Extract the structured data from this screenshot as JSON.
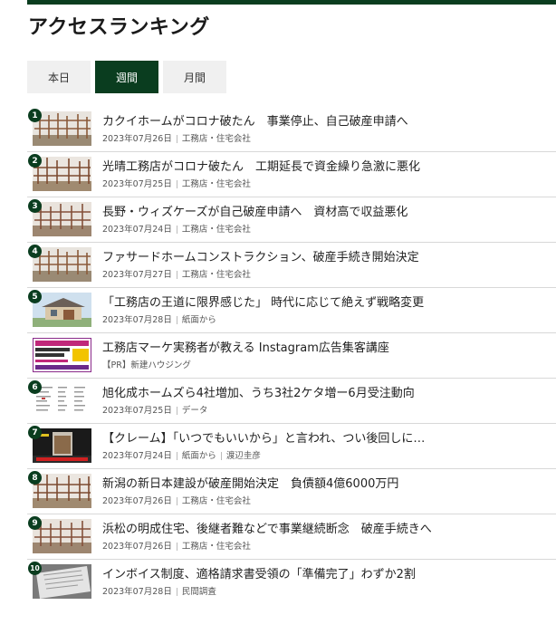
{
  "header": {
    "title": "アクセスランキング"
  },
  "tabs": [
    {
      "label": "本日"
    },
    {
      "label": "週間"
    },
    {
      "label": "月間"
    }
  ],
  "items": [
    {
      "rank": "1",
      "headline": "カクイホームがコロナ破たん　事業停止、自己破産申請へ",
      "date": "2023年07月26日",
      "category": "工務店・住宅会社",
      "author": ""
    },
    {
      "rank": "2",
      "headline": "光晴工務店がコロナ破たん　工期延長で資金繰り急激に悪化",
      "date": "2023年07月25日",
      "category": "工務店・住宅会社",
      "author": ""
    },
    {
      "rank": "3",
      "headline": "長野・ウィズケーズが自己破産申請へ　資材高で収益悪化",
      "date": "2023年07月24日",
      "category": "工務店・住宅会社",
      "author": ""
    },
    {
      "rank": "4",
      "headline": "ファサードホームコンストラクション、破産手続き開始決定",
      "date": "2023年07月27日",
      "category": "工務店・住宅会社",
      "author": ""
    },
    {
      "rank": "5",
      "headline": "「工務店の王道に限界感じた」 時代に応じて絶えず戦略変更",
      "date": "2023年07月28日",
      "category": "紙面から",
      "author": ""
    },
    {
      "rank": "",
      "headline": "工務店マーケ実務者が教える Instagram広告集客講座",
      "date": "【PR】新建ハウジング",
      "category": "",
      "author": ""
    },
    {
      "rank": "6",
      "headline": "旭化成ホームズら4社増加、うち3社2ケタ増ー6月受注動向",
      "date": "2023年07月25日",
      "category": "データ",
      "author": ""
    },
    {
      "rank": "7",
      "headline": "【クレーム】「いつでもいいから」と言われ、つい後回しに…",
      "date": "2023年07月24日",
      "category": "紙面から",
      "author": "渡辺圭彦"
    },
    {
      "rank": "8",
      "headline": "新潟の新日本建設が破産開始決定　負債額4億6000万円",
      "date": "2023年07月26日",
      "category": "工務店・住宅会社",
      "author": ""
    },
    {
      "rank": "9",
      "headline": "浜松の明成住宅、後継者難などで事業継続断念　破産手続きへ",
      "date": "2023年07月26日",
      "category": "工務店・住宅会社",
      "author": ""
    },
    {
      "rank": "10",
      "headline": "インボイス制度、適格請求書受領の「準備完了」わずか2割",
      "date": "2023年07月28日",
      "category": "民間調査",
      "author": ""
    }
  ]
}
